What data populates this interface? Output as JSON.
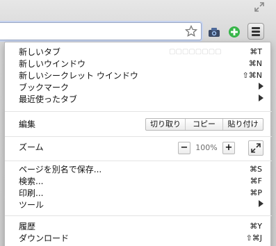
{
  "toolbar": {
    "star_icon": "star-icon",
    "extensions": [
      "camera-extension-icon",
      "plus-extension-icon"
    ],
    "menu_icon": "hamburger-icon"
  },
  "menu": {
    "items_top": [
      {
        "label": "新しいタブ",
        "shortcut": "⌘T"
      },
      {
        "label": "新しいウインドウ",
        "shortcut": "⌘N"
      },
      {
        "label": "新しいシークレット ウインドウ",
        "shortcut": "⇧⌘N"
      },
      {
        "label": "ブックマーク",
        "submenu": true
      },
      {
        "label": "最近使ったタブ",
        "submenu": true
      }
    ],
    "edit": {
      "label": "編集",
      "cut": "切り取り",
      "copy": "コピー",
      "paste": "貼り付け"
    },
    "zoom": {
      "label": "ズーム",
      "minus": "−",
      "value": "100%",
      "plus": "+"
    },
    "items_mid": [
      {
        "label": "ページを別名で保存...",
        "shortcut": "⌘S"
      },
      {
        "label": "検索...",
        "shortcut": "⌘F"
      },
      {
        "label": "印刷...",
        "shortcut": "⌘P"
      },
      {
        "label": "ツール",
        "submenu": true
      }
    ],
    "items_bottom": [
      {
        "label": "履歴",
        "shortcut": "⌘Y"
      },
      {
        "label": "ダウンロード",
        "shortcut": "⇧⌘J"
      }
    ]
  }
}
